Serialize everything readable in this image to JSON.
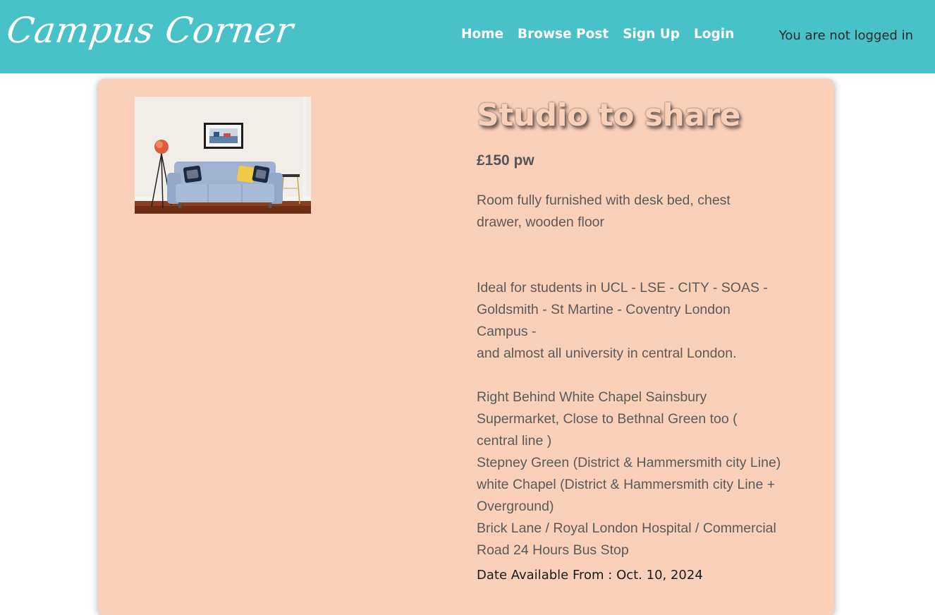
{
  "nav": {
    "brand": "Campus Corner",
    "links": [
      {
        "label": "Home"
      },
      {
        "label": "Browse Post"
      },
      {
        "label": "Sign Up"
      },
      {
        "label": "Login"
      }
    ],
    "status": "You are not logged in"
  },
  "colors": {
    "navbar_bg": "#49c1c9",
    "card_bg": "#fbd0b9",
    "nav_text": "#ffffff"
  },
  "post": {
    "title": "Studio to share",
    "price": "£150 pw",
    "description": "Room fully furnished with desk bed, chest\ndrawer, wooden floor\n\n\nIdeal for students in UCL - LSE - CITY - SOAS -\nGoldsmith - St Martine - Coventry London\nCampus -\nand almost all university in central London.\n\nRight Behind White Chapel Sainsbury\nSupermarket, Close to Bethnal Green too (\ncentral line )\nStepney Green (District & Hammersmith city Line)\nwhite Chapel (District & Hammersmith city Line +\nOverground)\nBrick Lane / Royal London Hospital / Commercial\nRoad 24 Hours Bus Stop",
    "date_label": "Date Available From :",
    "date_value": "Oct. 10, 2024"
  }
}
